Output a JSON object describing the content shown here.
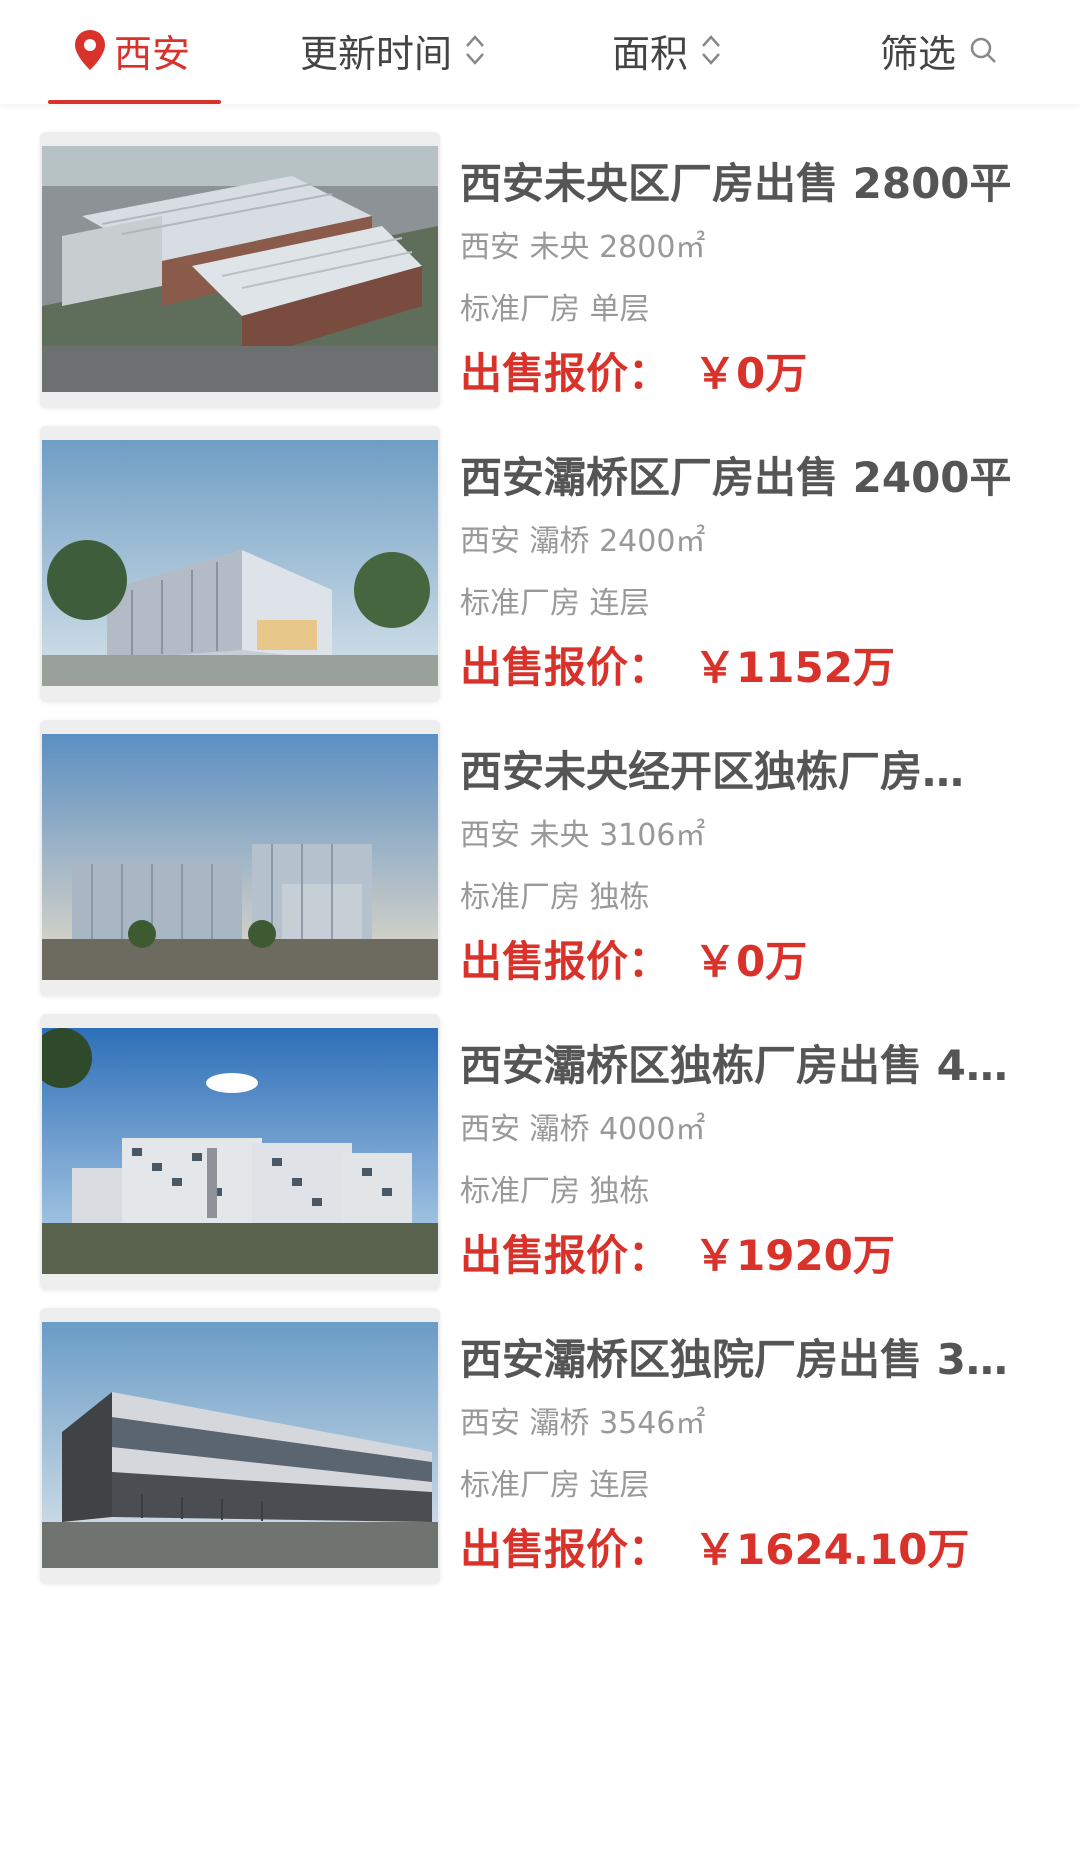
{
  "header": {
    "city_label": "西安",
    "sort_time_label": "更新时间",
    "sort_area_label": "面积",
    "filter_label": "筛选"
  },
  "listings": [
    {
      "title": "西安未央区厂房出售 2800平",
      "location": "西安 未央 2800㎡",
      "tags": "标准厂房 单层",
      "price_label": "出售报价：",
      "price_value": "￥0万"
    },
    {
      "title": "西安灞桥区厂房出售 2400平",
      "location": "西安 灞桥 2400㎡",
      "tags": "标准厂房 连层",
      "price_label": "出售报价：",
      "price_value": "￥1152万"
    },
    {
      "title": "西安未央经开区独栋厂房…",
      "location": "西安 未央 3106㎡",
      "tags": "标准厂房 独栋",
      "price_label": "出售报价：",
      "price_value": "￥0万"
    },
    {
      "title": "西安灞桥区独栋厂房出售 4…",
      "location": "西安 灞桥 4000㎡",
      "tags": "标准厂房 独栋",
      "price_label": "出售报价：",
      "price_value": "￥1920万"
    },
    {
      "title": "西安灞桥区独院厂房出售 3…",
      "location": "西安 灞桥 3546㎡",
      "tags": "标准厂房 连层",
      "price_label": "出售报价：",
      "price_value": "￥1624.10万"
    }
  ],
  "colors": {
    "accent": "#d8322a",
    "title_text": "#555555",
    "meta_text": "#999999"
  },
  "icons": [
    "location-pin-icon",
    "sort-arrows-icon",
    "search-icon"
  ]
}
